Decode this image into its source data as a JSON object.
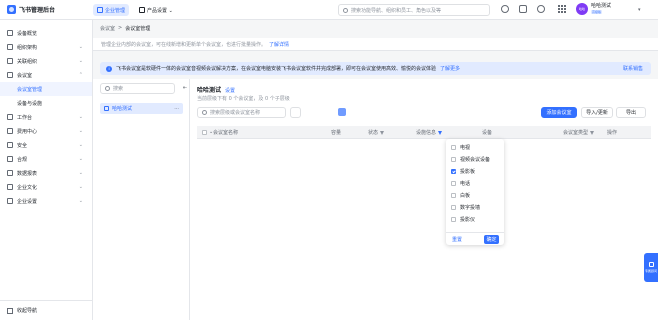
{
  "topbar": {
    "app_title": "飞书管理后台",
    "tabs": [
      {
        "label": "企业管理"
      },
      {
        "label": "产品设置 ⌄"
      }
    ],
    "search_placeholder": "搜索功能导航、组织和员工、角色以及等",
    "user_name": "哈哈测试",
    "user_badge": "高级版",
    "avatar_text": "哈哈"
  },
  "sidebar": {
    "items": [
      {
        "label": "设备概览"
      },
      {
        "label": "组织架构"
      },
      {
        "label": "关联组织"
      },
      {
        "label": "会议室"
      },
      {
        "label": "会议室管理"
      },
      {
        "label": "设备与设施"
      },
      {
        "label": "工作台"
      },
      {
        "label": "费用中心"
      },
      {
        "label": "安全"
      },
      {
        "label": "合规"
      },
      {
        "label": "数据报表"
      },
      {
        "label": "企业文化"
      },
      {
        "label": "企业设置"
      }
    ],
    "footer": "收起导航"
  },
  "breadcrumb": {
    "parent": "会议室",
    "sep": ">",
    "current": "会议室管理"
  },
  "description": {
    "text": "管理企业内部的会议室，可在线新增和更新单个会议室，也进行批量操作。",
    "link": "了解详情"
  },
  "notice": {
    "text": "飞书会议室是软硬件一体的会议室音视频会议解决方案，在会议室电脑安装飞书会议室软件并完成部署，即可在会议室使用高效、愉悦的会议体验",
    "link": "了解更多",
    "right": "联系销售"
  },
  "left_panel": {
    "search_placeholder": "搜索",
    "item_label": "哈哈测试",
    "more": "···",
    "collapse": "⇤"
  },
  "right": {
    "title": "哈哈测试",
    "edit_link": "设置",
    "subtitle": "当前层级下有 0 个会议室，及 0 个子层级",
    "search_placeholder": "搜索层级或会议室名称",
    "buttons": {
      "add": "添加会议室",
      "import_update": "导入/更新",
      "export": "导出"
    },
    "columns": [
      "会议室名称",
      "容量",
      "状态",
      "设施信息",
      "设备",
      "会议室类型",
      "操作"
    ]
  },
  "filter_popover": {
    "options": [
      {
        "label": "电视",
        "checked": false
      },
      {
        "label": "视频会议设备",
        "checked": false
      },
      {
        "label": "投影板",
        "checked": true
      },
      {
        "label": "电话",
        "checked": false
      },
      {
        "label": "白板",
        "checked": false
      },
      {
        "label": "数字投墙",
        "checked": false
      },
      {
        "label": "投影仪",
        "checked": false
      }
    ],
    "reset": "重置",
    "confirm": "确定"
  },
  "help_button": {
    "label": "专属顾问"
  },
  "colors": {
    "accent": "#3370ff",
    "accent_light": "#e1eaff",
    "avatar": "#7f3bf5"
  }
}
